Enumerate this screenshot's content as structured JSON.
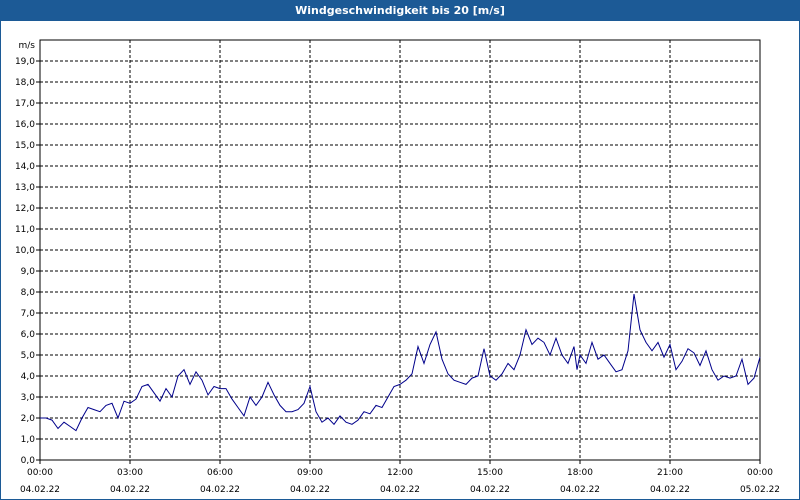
{
  "window": {
    "title": "Windgeschwindigkeit bis 20 [m/s]"
  },
  "chart_data": {
    "type": "line",
    "title": "Windgeschwindigkeit bis 20 [m/s]",
    "unit_label": "m/s",
    "ylim": [
      0,
      20
    ],
    "yticks": [
      "0,0",
      "1,0",
      "2,0",
      "3,0",
      "4,0",
      "5,0",
      "6,0",
      "7,0",
      "8,0",
      "9,0",
      "10,0",
      "11,0",
      "12,0",
      "13,0",
      "14,0",
      "15,0",
      "16,0",
      "17,0",
      "18,0",
      "19,0"
    ],
    "xlim_hours": [
      0,
      24
    ],
    "xticks": [
      {
        "time": "00:00",
        "date": "04.02.22"
      },
      {
        "time": "03:00",
        "date": "04.02.22"
      },
      {
        "time": "06:00",
        "date": "04.02.22"
      },
      {
        "time": "09:00",
        "date": "04.02.22"
      },
      {
        "time": "12:00",
        "date": "04.02.22"
      },
      {
        "time": "15:00",
        "date": "04.02.22"
      },
      {
        "time": "18:00",
        "date": "04.02.22"
      },
      {
        "time": "21:00",
        "date": "04.02.22"
      },
      {
        "time": "00:00",
        "date": "05.02.22"
      }
    ],
    "grid": true,
    "line_color": "#00008b",
    "series": [
      {
        "x_hours": [
          0,
          0.2,
          0.4,
          0.6,
          0.8,
          1.0,
          1.2,
          1.4,
          1.6,
          1.8,
          2.0,
          2.2,
          2.4,
          2.6,
          2.8,
          3.0,
          3.2,
          3.4,
          3.6,
          3.8,
          4.0,
          4.2,
          4.4,
          4.6,
          4.8,
          5.0,
          5.2,
          5.4,
          5.6,
          5.8,
          6.0,
          6.2,
          6.4,
          6.6,
          6.8,
          7.0,
          7.2,
          7.4,
          7.6,
          7.8,
          8.0,
          8.2,
          8.4,
          8.6,
          8.8,
          9.0,
          9.2,
          9.4,
          9.6,
          9.8,
          10.0,
          10.2,
          10.4,
          10.6,
          10.8,
          11.0,
          11.2,
          11.4,
          11.6,
          11.8,
          12.0,
          12.2,
          12.4,
          12.6,
          12.8,
          13.0,
          13.2,
          13.4,
          13.6,
          13.8,
          14.0,
          14.2,
          14.4,
          14.6,
          14.8,
          15.0,
          15.2,
          15.4,
          15.6,
          15.8,
          16.0,
          16.2,
          16.4,
          16.6,
          16.8,
          17.0,
          17.2,
          17.4,
          17.6,
          17.8,
          17.9,
          18.0,
          18.2,
          18.4,
          18.6,
          18.8,
          19.0,
          19.2,
          19.4,
          19.6,
          19.8,
          20.0,
          20.2,
          20.4,
          20.6,
          20.8,
          21.0,
          21.2,
          21.4,
          21.6,
          21.8,
          22.0,
          22.2,
          22.4,
          22.6,
          22.8,
          23.0,
          23.2,
          23.4,
          23.6,
          23.8,
          24.0
        ],
        "y": [
          2.0,
          2.0,
          1.9,
          1.5,
          1.8,
          1.6,
          1.4,
          2.0,
          2.5,
          2.4,
          2.3,
          2.6,
          2.7,
          2.0,
          2.8,
          2.7,
          2.9,
          3.5,
          3.6,
          3.2,
          2.8,
          3.4,
          3.0,
          4.0,
          4.3,
          3.6,
          4.2,
          3.8,
          3.1,
          3.5,
          3.4,
          3.4,
          2.9,
          2.5,
          2.1,
          3.0,
          2.6,
          3.0,
          3.7,
          3.1,
          2.6,
          2.3,
          2.3,
          2.4,
          2.7,
          3.5,
          2.3,
          1.8,
          2.0,
          1.7,
          2.1,
          1.8,
          1.7,
          1.9,
          2.3,
          2.2,
          2.6,
          2.5,
          3.0,
          3.5,
          3.6,
          3.8,
          4.1,
          5.4,
          4.6,
          5.5,
          6.1,
          4.8,
          4.1,
          3.8,
          3.7,
          3.6,
          3.9,
          4.0,
          5.3,
          4.0,
          3.8,
          4.1,
          4.6,
          4.3,
          5.0,
          6.2,
          5.5,
          5.8,
          5.6,
          5.0,
          5.8,
          5.0,
          4.6,
          5.4,
          4.3,
          5.0,
          4.6,
          5.6,
          4.8,
          5.0,
          4.6,
          4.2,
          4.3,
          5.2,
          7.9,
          6.2,
          5.6,
          5.2,
          5.6,
          4.9,
          5.5,
          4.3,
          4.7,
          5.3,
          5.1,
          4.5,
          5.2,
          4.3,
          3.8,
          4.0,
          3.9,
          4.0,
          4.8,
          3.6,
          3.9,
          4.9
        ]
      }
    ]
  }
}
